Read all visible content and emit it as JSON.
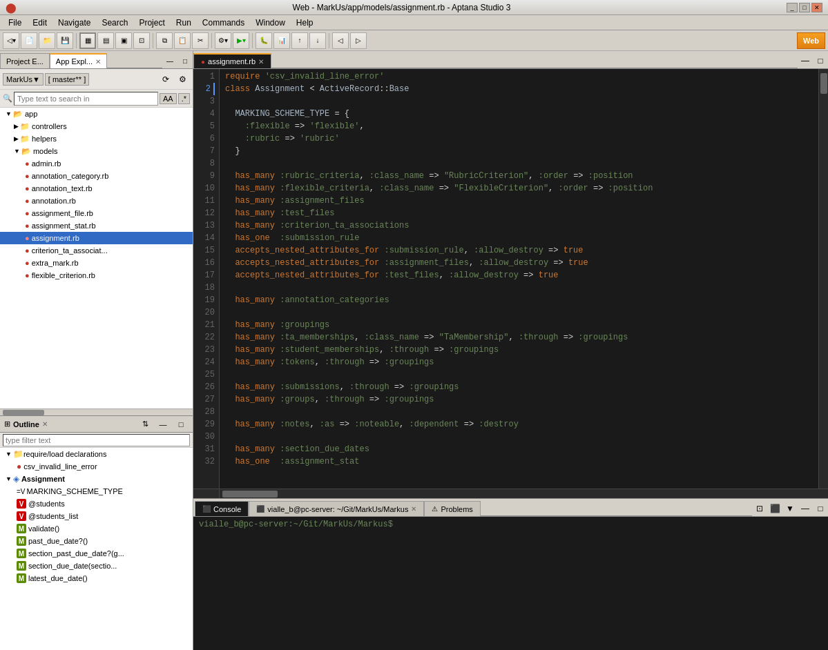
{
  "window": {
    "title": "Web - MarkUs/app/models/assignment.rb - Aptana Studio 3",
    "logo": "🔴"
  },
  "titlebar": {
    "minimize": "_",
    "maximize": "□",
    "close": "✕"
  },
  "menubar": {
    "items": [
      "File",
      "Edit",
      "Navigate",
      "Search",
      "Project",
      "Run",
      "Commands",
      "Window",
      "Help"
    ]
  },
  "explorer_tabs": [
    {
      "label": "Project E...",
      "active": false
    },
    {
      "label": "App Expl...",
      "active": true
    }
  ],
  "explorer": {
    "project": "MarkUs▼",
    "branch": "[ master** ]",
    "search_placeholder": "Type text to search in"
  },
  "file_tree": [
    {
      "indent": 0,
      "type": "folder",
      "open": true,
      "label": "app"
    },
    {
      "indent": 1,
      "type": "folder",
      "open": false,
      "label": "controllers"
    },
    {
      "indent": 1,
      "type": "folder",
      "open": false,
      "label": "helpers"
    },
    {
      "indent": 1,
      "type": "folder",
      "open": true,
      "label": "models"
    },
    {
      "indent": 2,
      "type": "file",
      "label": "admin.rb"
    },
    {
      "indent": 2,
      "type": "file",
      "label": "annotation_category.rb"
    },
    {
      "indent": 2,
      "type": "file",
      "label": "annotation_text.rb"
    },
    {
      "indent": 2,
      "type": "file",
      "label": "annotation.rb"
    },
    {
      "indent": 2,
      "type": "file",
      "label": "assignment_file.rb"
    },
    {
      "indent": 2,
      "type": "file",
      "label": "assignment_stat.rb"
    },
    {
      "indent": 2,
      "type": "file",
      "label": "assignment.rb",
      "selected": true
    },
    {
      "indent": 2,
      "type": "file",
      "label": "criterion_ta_associat..."
    },
    {
      "indent": 2,
      "type": "file",
      "label": "extra_mark.rb"
    },
    {
      "indent": 2,
      "type": "file",
      "label": "flexible_criterion.rb"
    }
  ],
  "outline": {
    "title": "Outline",
    "filter_placeholder": "type filter text",
    "items": [
      {
        "type": "group",
        "label": "require/load declarations",
        "open": true
      },
      {
        "type": "require",
        "indent": 1,
        "label": "csv_invalid_line_error"
      },
      {
        "type": "class",
        "indent": 0,
        "label": "Assignment",
        "open": true
      },
      {
        "type": "const",
        "indent": 1,
        "label": "=V MARKING_SCHEME_TYPE"
      },
      {
        "type": "v",
        "indent": 1,
        "label": "@students"
      },
      {
        "type": "v",
        "indent": 1,
        "label": "@students_list"
      },
      {
        "type": "m",
        "indent": 1,
        "label": "validate()"
      },
      {
        "type": "m",
        "indent": 1,
        "label": "past_due_date?()"
      },
      {
        "type": "m",
        "indent": 1,
        "label": "section_past_due_date?(g..."
      },
      {
        "type": "m",
        "indent": 1,
        "label": "section_due_date(sectio..."
      },
      {
        "type": "m",
        "indent": 1,
        "label": "latest_due_date()"
      }
    ]
  },
  "editor_tab": {
    "label": "assignment.rb",
    "active": true
  },
  "code_lines": [
    {
      "num": 1,
      "code": "require 'csv_invalid_line_error'"
    },
    {
      "num": 2,
      "code": "class Assignment < ActiveRecord::Base"
    },
    {
      "num": 3,
      "code": ""
    },
    {
      "num": 4,
      "code": "  MARKING_SCHEME_TYPE = {"
    },
    {
      "num": 5,
      "code": "    :flexible => 'flexible',"
    },
    {
      "num": 6,
      "code": "    :rubric => 'rubric'"
    },
    {
      "num": 7,
      "code": "  }"
    },
    {
      "num": 8,
      "code": ""
    },
    {
      "num": 9,
      "code": "  has_many :rubric_criteria, :class_name => \"RubricCriterion\", :order => :position"
    },
    {
      "num": 10,
      "code": "  has_many :flexible_criteria, :class_name => \"FlexibleCriterion\", :order => :position"
    },
    {
      "num": 11,
      "code": "  has_many :assignment_files"
    },
    {
      "num": 12,
      "code": "  has_many :test_files"
    },
    {
      "num": 13,
      "code": "  has_many :criterion_ta_associations"
    },
    {
      "num": 14,
      "code": "  has_one  :submission_rule"
    },
    {
      "num": 15,
      "code": "  accepts_nested_attributes_for :submission_rule, :allow_destroy => true"
    },
    {
      "num": 16,
      "code": "  accepts_nested_attributes_for :assignment_files, :allow_destroy => true"
    },
    {
      "num": 17,
      "code": "  accepts_nested_attributes_for :test_files, :allow_destroy => true"
    },
    {
      "num": 18,
      "code": ""
    },
    {
      "num": 19,
      "code": "  has_many :annotation_categories"
    },
    {
      "num": 20,
      "code": ""
    },
    {
      "num": 21,
      "code": "  has_many :groupings"
    },
    {
      "num": 22,
      "code": "  has_many :ta_memberships, :class_name => \"TaMembership\", :through => :groupings"
    },
    {
      "num": 23,
      "code": "  has_many :student_memberships, :through => :groupings"
    },
    {
      "num": 24,
      "code": "  has_many :tokens, :through => :groupings"
    },
    {
      "num": 25,
      "code": ""
    },
    {
      "num": 26,
      "code": "  has_many :submissions, :through => :groupings"
    },
    {
      "num": 27,
      "code": "  has_many :groups, :through => :groupings"
    },
    {
      "num": 28,
      "code": ""
    },
    {
      "num": 29,
      "code": "  has_many :notes, :as => :noteable, :dependent => :destroy"
    },
    {
      "num": 30,
      "code": ""
    },
    {
      "num": 31,
      "code": "  has_many :section_due_dates"
    },
    {
      "num": 32,
      "code": "  has_one  :assignment_stat"
    }
  ],
  "console": {
    "tab_label": "Console",
    "terminal_tab": "vialle_b@pc-server: ~/Git/MarkUs/Markus",
    "problems_tab": "Problems",
    "prompt": "vialle_b@pc-server:~/Git/MarkUs/Markus$"
  },
  "statusbar": {
    "icon": "●",
    "file_path": "MarkUs/app/models/assignment.rb"
  }
}
